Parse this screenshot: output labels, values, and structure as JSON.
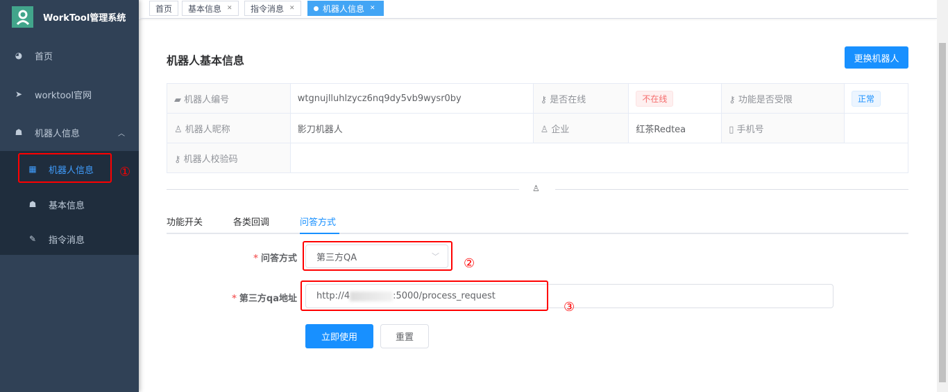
{
  "app": {
    "title": "WorkTool管理系统"
  },
  "sidebar": {
    "items": [
      {
        "label": "首页"
      },
      {
        "label": "worktool官网"
      },
      {
        "label": "机器人信息"
      }
    ],
    "sub_items": [
      {
        "label": "机器人信息"
      },
      {
        "label": "基本信息"
      },
      {
        "label": "指令消息"
      }
    ]
  },
  "tabs": [
    {
      "label": "首页"
    },
    {
      "label": "基本信息"
    },
    {
      "label": "指令消息"
    },
    {
      "label": "机器人信息"
    }
  ],
  "page": {
    "title": "机器人基本信息",
    "change_button": "更换机器人"
  },
  "info": {
    "robot_id_label": "机器人编号",
    "robot_id": "wtgnujlluhlzycz6nq9dy5vb9wysr0by",
    "online_label": "是否在线",
    "online": "不在线",
    "limited_label": "功能是否受限",
    "limited": "正常",
    "nickname_label": "机器人昵称",
    "nickname": "影刀机器人",
    "company_label": "企业",
    "company": "红茶Redtea",
    "phone_label": "手机号",
    "phone": "",
    "verify_label": "机器人校验码",
    "verify": ""
  },
  "func_tabs": [
    {
      "label": "功能开关"
    },
    {
      "label": "各类回调"
    },
    {
      "label": "问答方式"
    }
  ],
  "form": {
    "qa_mode_label": "问答方式",
    "qa_mode": "第三方QA",
    "qa_url_label": "第三方qa地址",
    "qa_url_prefix": "http://4",
    "qa_url_suffix": ":5000/process_request",
    "submit": "立即使用",
    "reset": "重置"
  },
  "annotations": [
    "①",
    "②",
    "③"
  ],
  "colors": {
    "sidebar": "#304156",
    "primary": "#1890ff",
    "danger": "#f56c6c",
    "annotation": "#ff0000"
  }
}
